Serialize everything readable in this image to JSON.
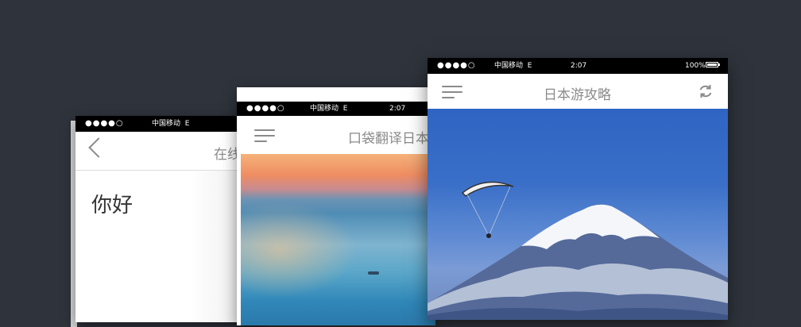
{
  "phones": [
    {
      "status": {
        "signal": "●●●●○",
        "carrier": "中国移动",
        "network": "E"
      },
      "nav": {
        "title": "在线"
      },
      "content": {
        "text": "你好"
      }
    },
    {
      "status": {
        "signal": "●●●●○",
        "carrier": "中国移动",
        "network": "E",
        "time": "2:07"
      },
      "nav": {
        "title": "口袋翻译日本"
      }
    },
    {
      "status": {
        "signal": "●●●●○",
        "carrier": "中国移动",
        "network": "E",
        "time": "2:07",
        "battery": "100%"
      },
      "nav": {
        "title": "日本游攻略"
      }
    }
  ],
  "icons": {
    "back": "chevron-left-icon",
    "menu": "hamburger-menu-icon",
    "refresh": "refresh-icon",
    "battery": "battery-icon"
  },
  "colors": {
    "background": "#2f343c",
    "statusbar": "#000000",
    "nav_text": "#8a8a8a"
  }
}
